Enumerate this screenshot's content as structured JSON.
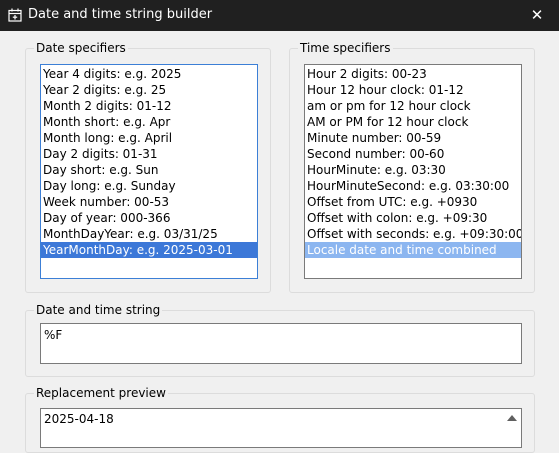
{
  "window": {
    "title": "Date and time string builder",
    "close_glyph": "✕"
  },
  "date_group": {
    "label": "Date specifiers",
    "items": [
      "Year 4 digits: e.g. 2025",
      "Year 2 digits: e.g. 25",
      "Month 2 digits: 01-12",
      "Month short: e.g. Apr",
      "Month long: e.g. April",
      "Day 2 digits: 01-31",
      "Day short: e.g. Sun",
      "Day long: e.g. Sunday",
      "Week number: 00-53",
      "Day of year: 000-366",
      "MonthDayYear: e.g. 03/31/25",
      "YearMonthDay: e.g. 2025-03-01"
    ],
    "selected_index": 11
  },
  "time_group": {
    "label": "Time specifiers",
    "items": [
      "Hour 2 digits: 00-23",
      "Hour 12 hour clock: 01-12",
      "am or pm for 12 hour clock",
      "AM or PM for 12 hour clock",
      "Minute number: 00-59",
      "Second number: 00-60",
      "HourMinute: e.g. 03:30",
      "HourMinuteSecond: e.g. 03:30:00",
      "Offset from UTC: e.g. +0930",
      "Offset with colon: e.g. +09:30",
      "Offset with seconds: e.g. +09:30:00",
      "Locale date and time combined"
    ],
    "selected_index": 11
  },
  "string_group": {
    "label": "Date and time string",
    "value": "%F"
  },
  "preview_group": {
    "label": "Replacement preview",
    "value": "2025-04-18"
  }
}
